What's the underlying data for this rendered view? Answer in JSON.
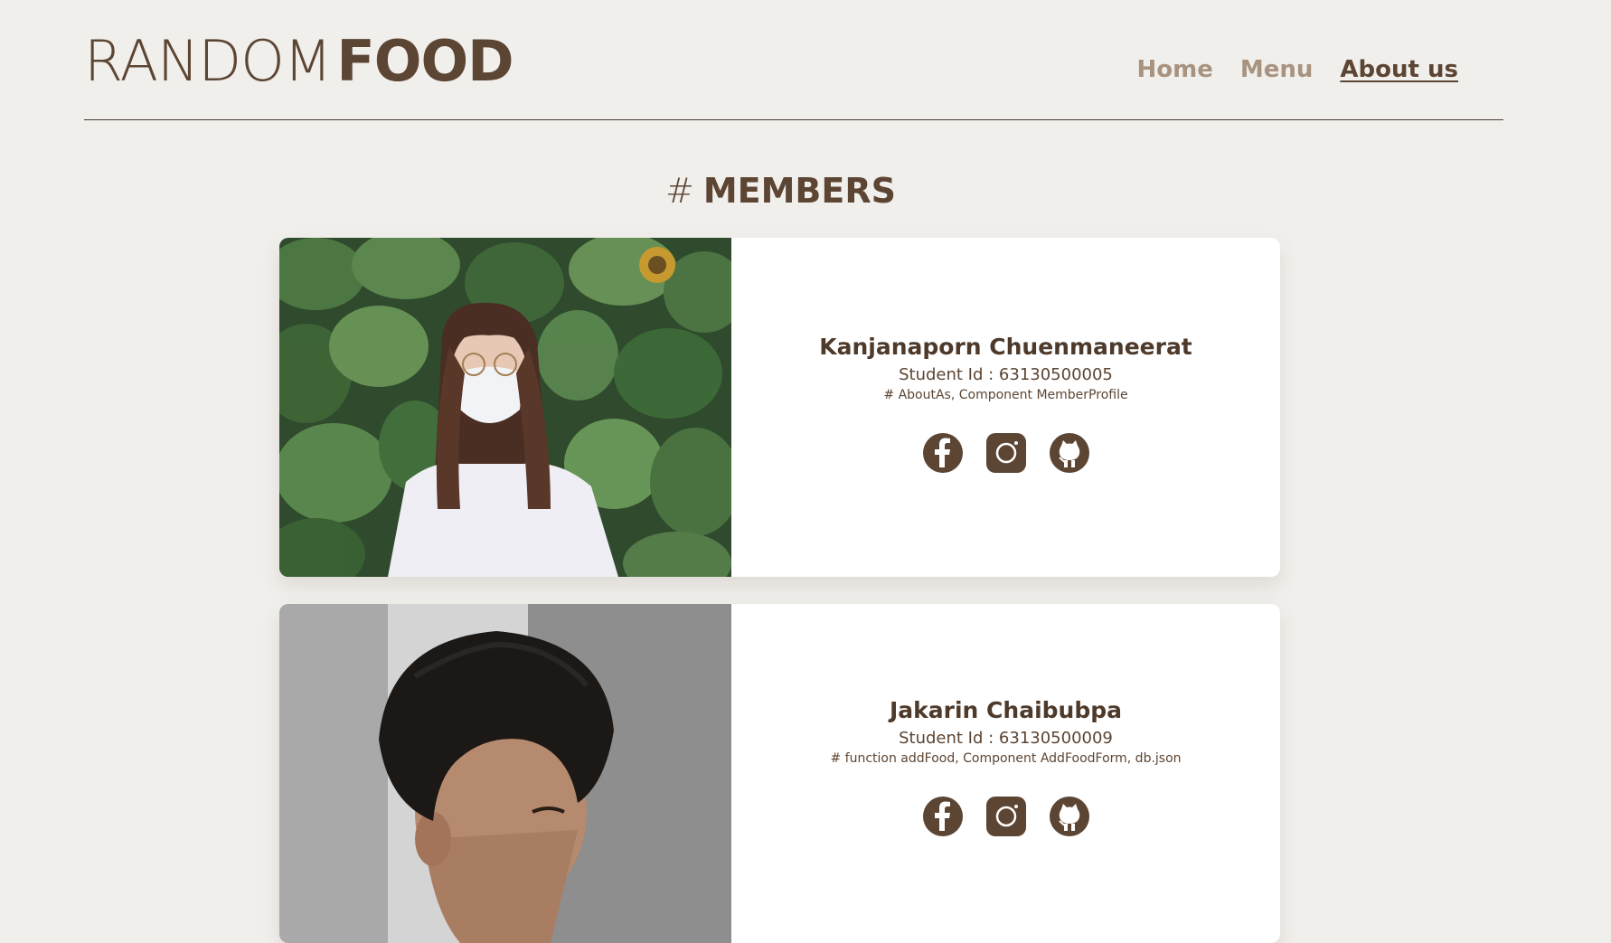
{
  "header": {
    "logo_light": "RANDOM",
    "logo_bold": "FOOD",
    "nav": [
      {
        "label": "Home",
        "active": false
      },
      {
        "label": "Menu",
        "active": false
      },
      {
        "label": "About us",
        "active": true
      }
    ]
  },
  "section": {
    "hash": "#",
    "title": "MEMBERS"
  },
  "members": [
    {
      "name": "Kanjanaporn Chuenmaneerat",
      "student_id": "Student Id : 63130500005",
      "tasks": "# AboutAs, Component MemberProfile",
      "socials": [
        "facebook-icon",
        "instagram-icon",
        "github-icon"
      ]
    },
    {
      "name": "Jakarin Chaibubpa",
      "student_id": "Student Id : 63130500009",
      "tasks": "# function addFood, Component AddFoodForm, db.json",
      "socials": [
        "facebook-icon",
        "instagram-icon",
        "github-icon"
      ]
    }
  ],
  "colors": {
    "background": "#f1efec",
    "brand_brown": "#5c4533",
    "nav_inactive": "#a89380",
    "card": "#ffffff"
  }
}
